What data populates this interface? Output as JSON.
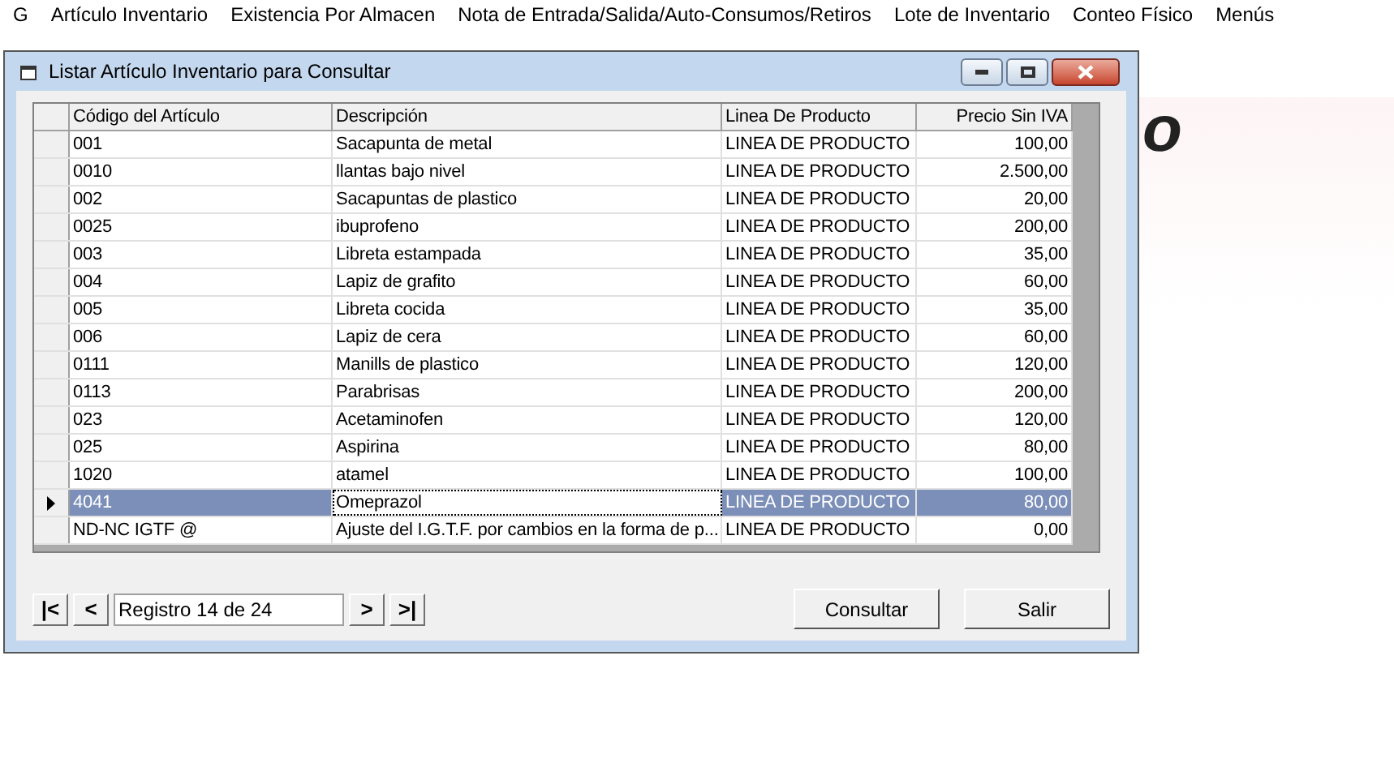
{
  "menu": [
    "G",
    "Artículo Inventario",
    "Existencia Por Almacen",
    "Nota de Entrada/Salida/Auto-Consumos/Retiros",
    "Lote de Inventario",
    "Conteo Físico",
    "Menús"
  ],
  "background": {
    "logo_text": "o"
  },
  "window": {
    "title": "Listar Artículo Inventario para Consultar"
  },
  "table": {
    "columns": [
      "Código del Artículo",
      "Descripción",
      "Linea De Producto",
      "Precio Sin IVA"
    ],
    "rows": [
      {
        "cells": [
          "001",
          "Sacapunta de metal",
          "LINEA DE PRODUCTO",
          "100,00"
        ],
        "selected": false
      },
      {
        "cells": [
          "0010",
          "llantas bajo nivel",
          "LINEA DE PRODUCTO",
          "2.500,00"
        ],
        "selected": false
      },
      {
        "cells": [
          "002",
          "Sacapuntas de plastico",
          "LINEA DE PRODUCTO",
          "20,00"
        ],
        "selected": false
      },
      {
        "cells": [
          "0025",
          "ibuprofeno",
          "LINEA DE PRODUCTO",
          "200,00"
        ],
        "selected": false
      },
      {
        "cells": [
          "003",
          "Libreta estampada",
          "LINEA DE PRODUCTO",
          "35,00"
        ],
        "selected": false
      },
      {
        "cells": [
          "004",
          "Lapiz de grafito",
          "LINEA DE PRODUCTO",
          "60,00"
        ],
        "selected": false
      },
      {
        "cells": [
          "005",
          "Libreta cocida",
          "LINEA DE PRODUCTO",
          "35,00"
        ],
        "selected": false
      },
      {
        "cells": [
          "006",
          "Lapiz de cera",
          "LINEA DE PRODUCTO",
          "60,00"
        ],
        "selected": false
      },
      {
        "cells": [
          "0111",
          "Manills de plastico",
          "LINEA DE PRODUCTO",
          "120,00"
        ],
        "selected": false
      },
      {
        "cells": [
          "0113",
          "Parabrisas",
          "LINEA DE PRODUCTO",
          "200,00"
        ],
        "selected": false
      },
      {
        "cells": [
          "023",
          "Acetaminofen",
          "LINEA DE PRODUCTO",
          "120,00"
        ],
        "selected": false
      },
      {
        "cells": [
          "025",
          "Aspirina",
          "LINEA DE PRODUCTO",
          "80,00"
        ],
        "selected": false
      },
      {
        "cells": [
          "1020",
          "atamel",
          "LINEA DE PRODUCTO",
          "100,00"
        ],
        "selected": false
      },
      {
        "cells": [
          "4041",
          "Omeprazol",
          "LINEA DE PRODUCTO",
          "80,00"
        ],
        "selected": true
      },
      {
        "cells": [
          "ND-NC IGTF @",
          "Ajuste del I.G.T.F. por cambios en la forma de p...",
          "LINEA DE PRODUCTO",
          "0,00"
        ],
        "selected": false
      }
    ]
  },
  "navigator": {
    "first": "|<",
    "prev": "<",
    "record": "Registro 14 de 24",
    "next": ">",
    "last": ">|"
  },
  "buttons": [
    "Consultar",
    "Salir"
  ]
}
